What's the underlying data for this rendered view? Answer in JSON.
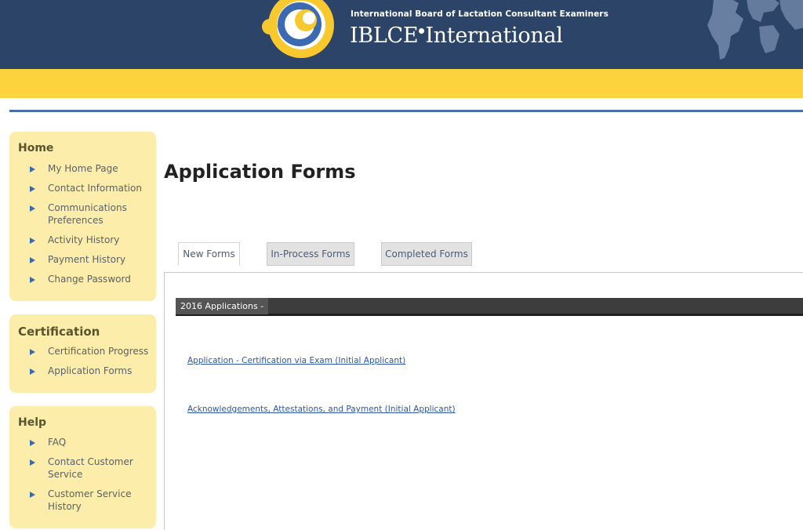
{
  "header": {
    "tagline": "International Board of Lactation Consultant Examiners",
    "brand_left": "IBLCE",
    "brand_right": "International"
  },
  "colors": {
    "header_bg": "#2c4468",
    "band": "#fdd33d",
    "sidebar_bg": "#fdedab",
    "link": "#2b57a6"
  },
  "sidebar": {
    "home": {
      "title": "Home",
      "items": [
        "My Home Page",
        "Contact Information",
        "Communications Preferences",
        "Activity History",
        "Payment History",
        "Change Password"
      ]
    },
    "certification": {
      "title": "Certification",
      "items": [
        "Certification Progress",
        "Application Forms"
      ]
    },
    "help": {
      "title": "Help",
      "items": [
        "FAQ",
        "Contact Customer Service",
        "Customer Service History"
      ]
    }
  },
  "main": {
    "title": "Application Forms",
    "tabs": [
      "New Forms",
      "In-Process Forms",
      "Completed Forms"
    ],
    "section_title": "2016 Applications -",
    "links": [
      "Application - Certification via Exam (Initial Applicant)",
      "Acknowledgements, Attestations, and Payment (Initial Applicant)"
    ]
  }
}
